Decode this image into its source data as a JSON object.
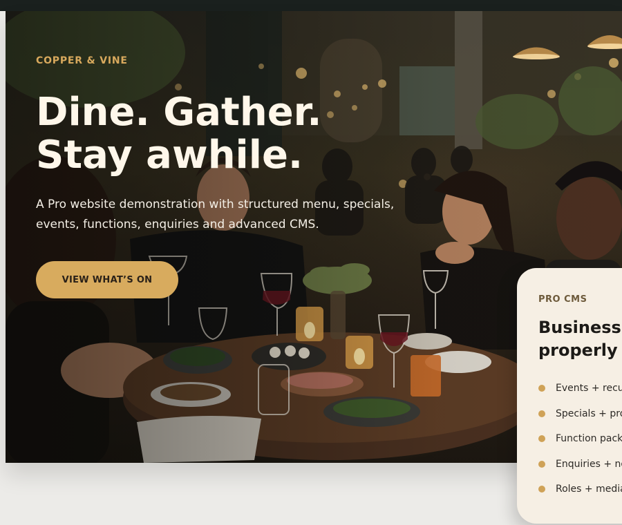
{
  "hero": {
    "eyebrow": "COPPER & VINE",
    "title_line1": "Dine. Gather.",
    "title_line2": "Stay awhile.",
    "description": "A Pro website demonstration with structured menu, specials, events, functions, enquiries and advanced CMS.",
    "cta_label": "VIEW WHAT’S ON"
  },
  "cms_card": {
    "eyebrow": "PRO CMS",
    "title_line1": "Business",
    "title_line2": "properly",
    "features": [
      {
        "label": "Events + recu"
      },
      {
        "label": "Specials + pro"
      },
      {
        "label": "Function packa"
      },
      {
        "label": "Enquiries + no"
      },
      {
        "label": "Roles + media"
      }
    ]
  },
  "colors": {
    "accent": "#d8ab5e",
    "topbar": "#1a201e",
    "card_bg": "#f6efe4",
    "page_bg": "#ecebe8"
  }
}
